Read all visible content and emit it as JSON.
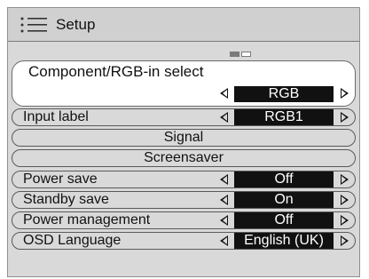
{
  "header": {
    "title": "Setup",
    "icon": "menu-list-icon"
  },
  "input_select": {
    "label": "Component/RGB-in  select",
    "value": "RGB"
  },
  "rows": [
    {
      "label": "Input label",
      "value": "RGB1"
    },
    {
      "label": "Signal"
    },
    {
      "label": "Screensaver"
    },
    {
      "label": "Power save",
      "value": "Off"
    },
    {
      "label": "Standby save",
      "value": "On"
    },
    {
      "label": "Power management",
      "value": "Off"
    },
    {
      "label": "OSD  Language",
      "value": "English (UK)"
    }
  ],
  "colors": {
    "selected_bg": "#ffffff",
    "menu_bg": "#d9d9d9",
    "value_bg": "#111111",
    "value_fg": "#ffffff"
  }
}
